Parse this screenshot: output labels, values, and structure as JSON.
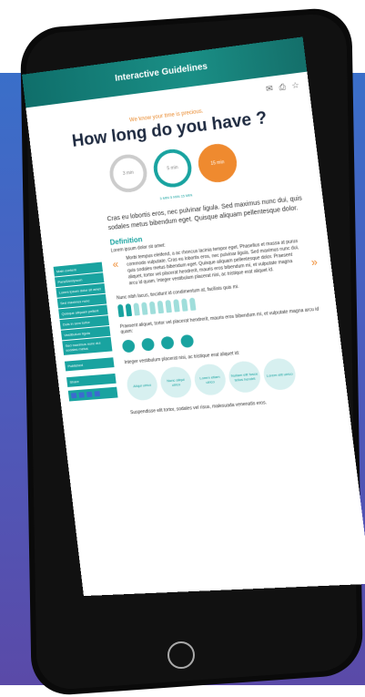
{
  "page": {
    "title": "Interactive Guidelines",
    "tagline": "We know your time is precious.",
    "headline": "How long do you have ?",
    "caption": "3 MIN  5 MIN  15 MIN",
    "intro": "Cras eu lobortis eros, nec pulvinar ligula. Sed maximus nunc dui, quis sodales metus bibendum eget. Quisque aliquam pellentesque dolor.",
    "definition_title": "Definition",
    "definition_lead": "Lorem ipsum dolor sit amet:",
    "quote": "Morbi tempus eleifend, a ac rhoncus lacinia tempor eget. Phasellus et massa at purus commodo vulputate. Cras eu lobortis eros, nec pulvinar ligula. Sed maximus nunc dui, quis sodales metus bibendum eget. Quisque aliquam pellentesque dolor. Praesent aliquet, tortor vel placerat hendrerit, mauris eros bibendum mi, et vulputate magna arcu id quam. Integer vestibulum placerat nisi, ac tristique erat aliquet id.",
    "bullet1": "Nunc nibh lacus, tincidunt id condimentum at, facilisis quis mi.",
    "bullet2": "Praesent aliquet, tortor vel placerat hendrerit, mauris eros bibendum mi, et vulputate magna arcu id quam:",
    "bullet3": "Integer vestibulum placerat nisi, ac tristique erat aliquet id:",
    "bullet4": "Suspendisse elit tortor, sodales vel risus, malesuada venenatis eros."
  },
  "sidenav": [
    "Main content",
    "Para/Dim/ipsum",
    "Lorem ipsum dolor sit amet",
    "Sed maximus nunc",
    "Quisque aliquam pellent",
    "Duis in sem tortor",
    "Vestibulum ligula",
    "Sed maximus nunc dui sodales metus"
  ],
  "meta": {
    "published": "Published",
    "share": "Share"
  },
  "rings": [
    "3 min",
    "5 min",
    "15 min"
  ],
  "circles": [
    "Aliqui ulrico",
    "Nunc aliqui ulrico",
    "Lorem etiam ulrico",
    "Nullam elit fusce tellus hendrit",
    "Lorem elit ulrico"
  ]
}
